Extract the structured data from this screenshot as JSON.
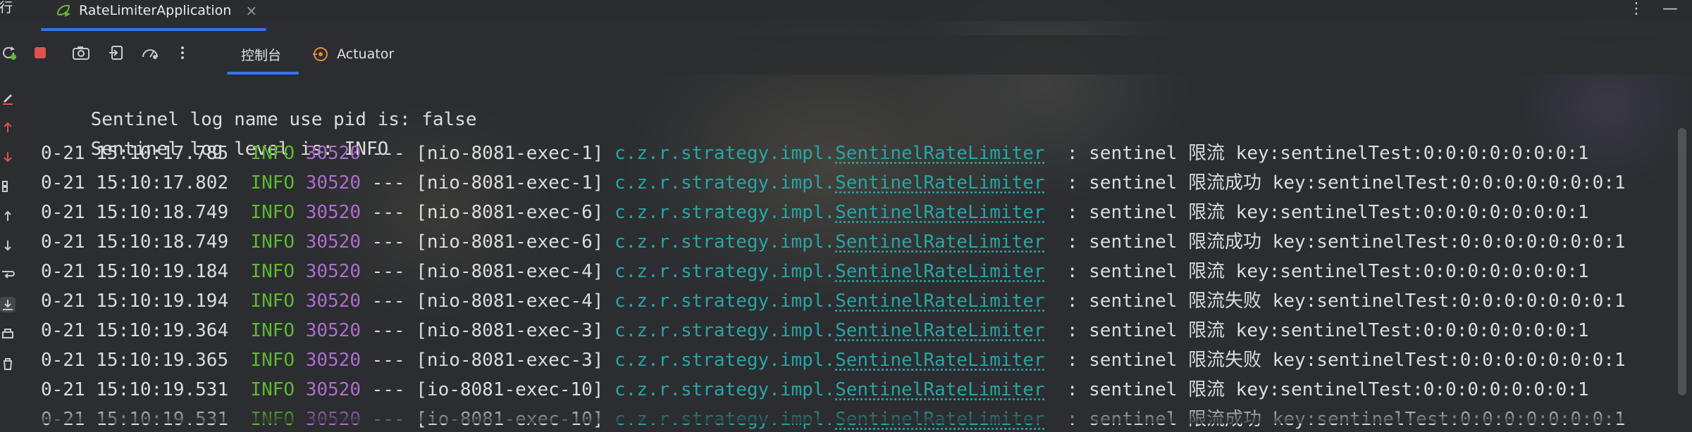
{
  "window": {
    "run_label": "运行",
    "active_tab": "RateLimiterApplication",
    "close_glyph": "×",
    "more_glyph": "⋮",
    "minimize_glyph": "—"
  },
  "toolbar": {
    "tabs": [
      {
        "label": "控制台"
      },
      {
        "label": "Actuator"
      }
    ]
  },
  "console": {
    "header_lines": [
      "Sentinel log name use pid is: false",
      "Sentinel log level is: INFO"
    ],
    "rows": [
      {
        "time": "0-21 15:10:17.785",
        "level": "INFO",
        "pid": "30520",
        "sep": "---",
        "thread": "[nio-8081-exec-1]",
        "cls_prefix": "c.z.r.strategy.impl.",
        "cls_name": "SentinelRateLimiter",
        "message": " : sentinel 限流 key:sentinelTest:0:0:0:0:0:0:0:1"
      },
      {
        "time": "0-21 15:10:17.802",
        "level": "INFO",
        "pid": "30520",
        "sep": "---",
        "thread": "[nio-8081-exec-1]",
        "cls_prefix": "c.z.r.strategy.impl.",
        "cls_name": "SentinelRateLimiter",
        "message": " : sentinel 限流成功 key:sentinelTest:0:0:0:0:0:0:0:1"
      },
      {
        "time": "0-21 15:10:18.749",
        "level": "INFO",
        "pid": "30520",
        "sep": "---",
        "thread": "[nio-8081-exec-6]",
        "cls_prefix": "c.z.r.strategy.impl.",
        "cls_name": "SentinelRateLimiter",
        "message": " : sentinel 限流 key:sentinelTest:0:0:0:0:0:0:0:1"
      },
      {
        "time": "0-21 15:10:18.749",
        "level": "INFO",
        "pid": "30520",
        "sep": "---",
        "thread": "[nio-8081-exec-6]",
        "cls_prefix": "c.z.r.strategy.impl.",
        "cls_name": "SentinelRateLimiter",
        "message": " : sentinel 限流成功 key:sentinelTest:0:0:0:0:0:0:0:1"
      },
      {
        "time": "0-21 15:10:19.184",
        "level": "INFO",
        "pid": "30520",
        "sep": "---",
        "thread": "[nio-8081-exec-4]",
        "cls_prefix": "c.z.r.strategy.impl.",
        "cls_name": "SentinelRateLimiter",
        "message": " : sentinel 限流 key:sentinelTest:0:0:0:0:0:0:0:1"
      },
      {
        "time": "0-21 15:10:19.194",
        "level": "INFO",
        "pid": "30520",
        "sep": "---",
        "thread": "[nio-8081-exec-4]",
        "cls_prefix": "c.z.r.strategy.impl.",
        "cls_name": "SentinelRateLimiter",
        "message": " : sentinel 限流失败 key:sentinelTest:0:0:0:0:0:0:0:1"
      },
      {
        "time": "0-21 15:10:19.364",
        "level": "INFO",
        "pid": "30520",
        "sep": "---",
        "thread": "[nio-8081-exec-3]",
        "cls_prefix": "c.z.r.strategy.impl.",
        "cls_name": "SentinelRateLimiter",
        "message": " : sentinel 限流 key:sentinelTest:0:0:0:0:0:0:0:1"
      },
      {
        "time": "0-21 15:10:19.365",
        "level": "INFO",
        "pid": "30520",
        "sep": "---",
        "thread": "[nio-8081-exec-3]",
        "cls_prefix": "c.z.r.strategy.impl.",
        "cls_name": "SentinelRateLimiter",
        "message": " : sentinel 限流失败 key:sentinelTest:0:0:0:0:0:0:0:1"
      },
      {
        "time": "0-21 15:10:19.531",
        "level": "INFO",
        "pid": "30520",
        "sep": "---",
        "thread": "[io-8081-exec-10]",
        "cls_prefix": "c.z.r.strategy.impl.",
        "cls_name": "SentinelRateLimiter",
        "message": " : sentinel 限流 key:sentinelTest:0:0:0:0:0:0:0:1"
      },
      {
        "time": "0-21 15:10:19.531",
        "level": "INFO",
        "pid": "30520",
        "sep": "---",
        "thread": "[io-8081-exec-10]",
        "cls_prefix": "c.z.r.strategy.impl.",
        "cls_name": "SentinelRateLimiter",
        "message": " : sentinel 限流成功 key:sentinelTest:0:0:0:0:0:0:0:1"
      }
    ]
  },
  "colors": {
    "background": "#2b2d30",
    "accent": "#3574f0",
    "info_level": "#5fb832",
    "pid": "#b06ccf",
    "class_link": "#26a6a6",
    "stop_red": "#d9534f"
  },
  "icons": {
    "tab": "spring-run-icon",
    "toolbar": [
      "rerun-icon",
      "stop-icon",
      "camera-icon",
      "exit-icon",
      "gauge-icon",
      "more-vertical-icon",
      "actuator-icon"
    ],
    "gutter": [
      "edit-icon",
      "arrow-up-icon",
      "arrow-down-icon",
      "grid-icon",
      "arrow-up-icon",
      "arrow-down-icon",
      "wrap-icon",
      "download-icon",
      "print-icon",
      "trash-icon"
    ]
  }
}
